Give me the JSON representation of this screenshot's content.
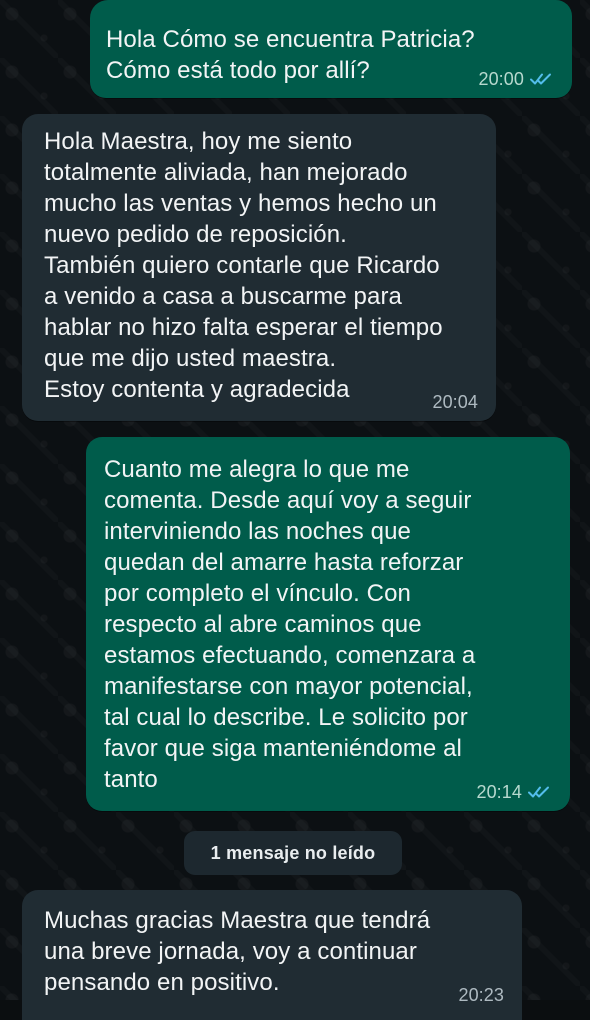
{
  "messages": [
    {
      "direction": "outgoing",
      "text": "Hola Cómo se encuentra Patricia?\nCómo está todo por allí?",
      "time": "20:00",
      "status": "read"
    },
    {
      "direction": "incoming",
      "text": "Hola Maestra, hoy me siento\ntotalmente aliviada, han mejorado\nmucho las ventas y  hemos hecho un\nnuevo pedido de reposición.\nTambién quiero contarle que Ricardo\na venido a casa a buscarme para\nhablar no hizo falta esperar el tiempo\nque me dijo usted maestra.\nEstoy contenta y agradecida",
      "time": "20:04"
    },
    {
      "direction": "outgoing",
      "text": "Cuanto me alegra lo que me\ncomenta. Desde aquí voy a seguir\ninterviniendo las noches que\nquedan del amarre  hasta reforzar\npor completo el vínculo. Con\nrespecto al abre caminos que\nestamos efectuando, comenzara a\nmanifestarse con mayor potencial,\ntal cual lo describe. Le solicito por\nfavor que siga manteniéndome al\ntanto",
      "time": "20:14",
      "status": "read"
    },
    {
      "direction": "incoming",
      "text": "Muchas gracias Maestra que tendrá\nuna breve jornada,  voy a continuar\npensando en positivo.",
      "time": "20:23"
    }
  ],
  "unread_divider": "1 mensaje no leído",
  "colors": {
    "incoming_bubble": "#202c33",
    "outgoing_bubble": "#005c4b",
    "read_ticks": "#53bdeb"
  },
  "icons": {
    "read_receipt": "double-check-icon"
  }
}
